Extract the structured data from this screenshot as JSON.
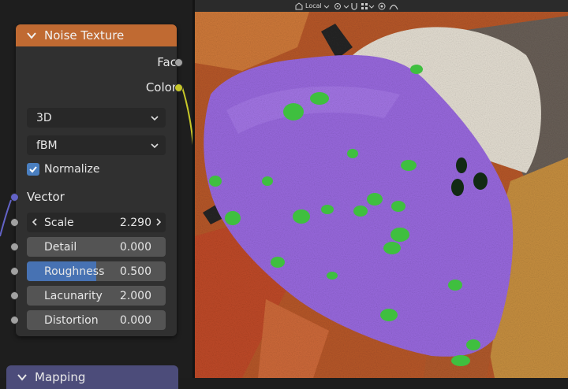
{
  "node_editor": {
    "noise_node": {
      "title": "Noise Texture",
      "outputs": [
        "Fac",
        "Color"
      ],
      "dimensions": "3D",
      "noise_type": "fBM",
      "normalize_label": "Normalize",
      "normalize_checked": true,
      "vector_label": "Vector",
      "fields": [
        {
          "name": "Scale",
          "value": "2.290"
        },
        {
          "name": "Detail",
          "value": "0.000"
        },
        {
          "name": "Roughness",
          "value": "0.500",
          "fill_fraction": 0.5
        },
        {
          "name": "Lacunarity",
          "value": "2.000"
        },
        {
          "name": "Distortion",
          "value": "0.000"
        }
      ]
    },
    "mapping_node": {
      "title": "Mapping"
    }
  },
  "viewport": {
    "header": {
      "transform_orientation": "Local"
    }
  },
  "colors": {
    "noise_header": "#c06a32",
    "mapping_header": "#4c4c7a",
    "object_purple": "#9a6ae0",
    "spot_green": "#3fbf3f",
    "accent_blue": "#4772b3"
  }
}
